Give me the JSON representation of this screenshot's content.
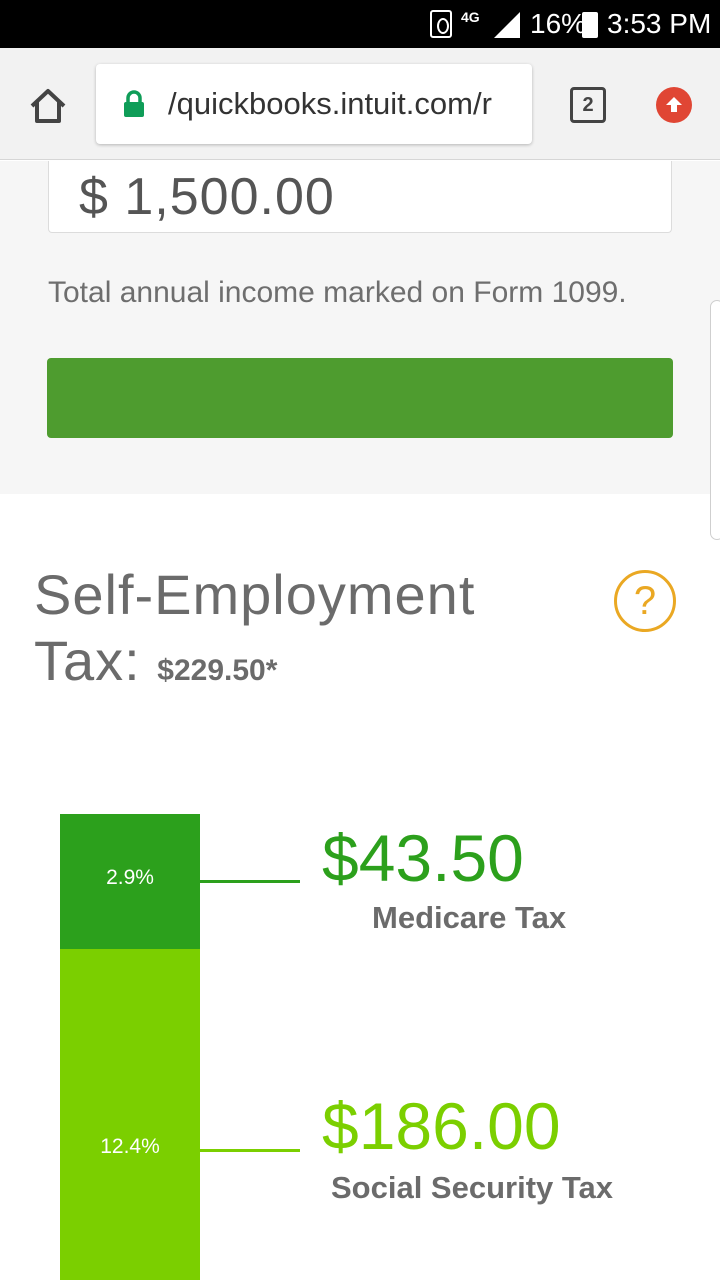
{
  "status_bar": {
    "network": "4G",
    "battery_percent": "16%",
    "time": "3:53 PM"
  },
  "browser": {
    "url_display": "/quickbooks.intuit.com/r",
    "tab_count": "2"
  },
  "form": {
    "income_value": "$ 1,500.00",
    "income_hint": "Total annual income marked on Form 1099.",
    "button_color": "#4e9c2f"
  },
  "tax": {
    "title": "Self-Employment Tax:",
    "amount": "$229.50*",
    "help_icon": "question-mark-circle-icon",
    "breakdown": [
      {
        "percent": "2.9%",
        "value": "$43.50",
        "label": "Medicare Tax",
        "color": "#2ca01c"
      },
      {
        "percent": "12.4%",
        "value": "$186.00",
        "label": "Social Security Tax",
        "color": "#7bcf00"
      }
    ]
  },
  "colors": {
    "accent_orange": "#eaa823",
    "update_red": "#e04634",
    "lock_green": "#0f9d58"
  }
}
